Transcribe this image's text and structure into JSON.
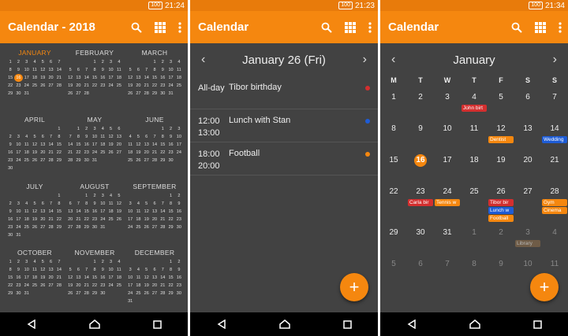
{
  "colors": {
    "accent": "#f5870f",
    "statusbar": "#e87b0b",
    "background": "#424242",
    "red": "#d32f2f",
    "blue": "#1e5cd6",
    "orange": "#f5870f",
    "brown": "#8d6e4b"
  },
  "status": [
    {
      "battery": "100",
      "time": "21:24"
    },
    {
      "battery": "100",
      "time": "21:23"
    },
    {
      "battery": "100",
      "time": "21:34"
    }
  ],
  "year_screen": {
    "title": "Calendar - 2018",
    "months": [
      {
        "name": "JANUARY",
        "current": true,
        "days": [
          "1",
          "2",
          "3",
          "4",
          "5",
          "6",
          "7",
          "8",
          "9",
          "10",
          "11",
          "12",
          "13",
          "14",
          "15",
          "16",
          "17",
          "18",
          "19",
          "20",
          "21",
          "22",
          "23",
          "24",
          "25",
          "26",
          "27",
          "28",
          "29",
          "30",
          "31"
        ],
        "offset": 0
      },
      {
        "name": "FEBRUARY",
        "days": [
          "1",
          "2",
          "3",
          "4",
          "5",
          "6",
          "7",
          "8",
          "9",
          "10",
          "11",
          "12",
          "13",
          "14",
          "15",
          "16",
          "17",
          "18",
          "19",
          "20",
          "21",
          "22",
          "23",
          "24",
          "25",
          "26",
          "27",
          "28"
        ],
        "offset": 3
      },
      {
        "name": "MARCH",
        "days": [
          "1",
          "2",
          "3",
          "4",
          "5",
          "6",
          "7",
          "8",
          "9",
          "10",
          "11",
          "12",
          "13",
          "14",
          "15",
          "16",
          "17",
          "18",
          "19",
          "20",
          "21",
          "22",
          "23",
          "24",
          "25",
          "26",
          "27",
          "28",
          "29",
          "30",
          "31"
        ],
        "offset": 3
      },
      {
        "name": "APRIL",
        "days": [
          "1",
          "2",
          "3",
          "4",
          "5",
          "6",
          "7",
          "8",
          "9",
          "10",
          "11",
          "12",
          "13",
          "14",
          "15",
          "16",
          "17",
          "18",
          "19",
          "20",
          "21",
          "22",
          "23",
          "24",
          "25",
          "26",
          "27",
          "28",
          "29",
          "30"
        ],
        "offset": 6
      },
      {
        "name": "MAY",
        "days": [
          "1",
          "2",
          "3",
          "4",
          "5",
          "6",
          "7",
          "8",
          "9",
          "10",
          "11",
          "12",
          "13",
          "14",
          "15",
          "16",
          "17",
          "18",
          "19",
          "20",
          "21",
          "22",
          "23",
          "24",
          "25",
          "26",
          "27",
          "28",
          "29",
          "30",
          "31"
        ],
        "offset": 1
      },
      {
        "name": "JUNE",
        "days": [
          "1",
          "2",
          "3",
          "4",
          "5",
          "6",
          "7",
          "8",
          "9",
          "10",
          "11",
          "12",
          "13",
          "14",
          "15",
          "16",
          "17",
          "18",
          "19",
          "20",
          "21",
          "22",
          "23",
          "24",
          "25",
          "26",
          "27",
          "28",
          "29",
          "30"
        ],
        "offset": 4
      },
      {
        "name": "JULY",
        "days": [
          "1",
          "2",
          "3",
          "4",
          "5",
          "6",
          "7",
          "8",
          "9",
          "10",
          "11",
          "12",
          "13",
          "14",
          "15",
          "16",
          "17",
          "18",
          "19",
          "20",
          "21",
          "22",
          "23",
          "24",
          "25",
          "26",
          "27",
          "28",
          "29",
          "30",
          "31"
        ],
        "offset": 6
      },
      {
        "name": "AUGUST",
        "days": [
          "1",
          "2",
          "3",
          "4",
          "5",
          "6",
          "7",
          "8",
          "9",
          "10",
          "11",
          "12",
          "13",
          "14",
          "15",
          "16",
          "17",
          "18",
          "19",
          "20",
          "21",
          "22",
          "23",
          "24",
          "25",
          "26",
          "27",
          "28",
          "29",
          "30",
          "31"
        ],
        "offset": 2
      },
      {
        "name": "SEPTEMBER",
        "days": [
          "1",
          "2",
          "3",
          "4",
          "5",
          "6",
          "7",
          "8",
          "9",
          "10",
          "11",
          "12",
          "13",
          "14",
          "15",
          "16",
          "17",
          "18",
          "19",
          "20",
          "21",
          "22",
          "23",
          "24",
          "25",
          "26",
          "27",
          "28",
          "29",
          "30"
        ],
        "offset": 5
      },
      {
        "name": "OCTOBER",
        "days": [
          "1",
          "2",
          "3",
          "4",
          "5",
          "6",
          "7",
          "8",
          "9",
          "10",
          "11",
          "12",
          "13",
          "14",
          "15",
          "16",
          "17",
          "18",
          "19",
          "20",
          "21",
          "22",
          "23",
          "24",
          "25",
          "26",
          "27",
          "28",
          "29",
          "30",
          "31"
        ],
        "offset": 0
      },
      {
        "name": "NOVEMBER",
        "days": [
          "1",
          "2",
          "3",
          "4",
          "5",
          "6",
          "7",
          "8",
          "9",
          "10",
          "11",
          "12",
          "13",
          "14",
          "15",
          "16",
          "17",
          "18",
          "19",
          "20",
          "21",
          "22",
          "23",
          "24",
          "25",
          "26",
          "27",
          "28",
          "29",
          "30"
        ],
        "offset": 3
      },
      {
        "name": "DECEMBER",
        "days": [
          "1",
          "2",
          "3",
          "4",
          "5",
          "6",
          "7",
          "8",
          "9",
          "10",
          "11",
          "12",
          "13",
          "14",
          "15",
          "16",
          "17",
          "18",
          "19",
          "20",
          "21",
          "22",
          "23",
          "24",
          "25",
          "26",
          "27",
          "28",
          "29",
          "30",
          "31"
        ],
        "offset": 5
      }
    ]
  },
  "day_screen": {
    "title": "Calendar",
    "date": "January 26 (Fri)",
    "events": [
      {
        "time": "All-day",
        "time2": "",
        "title": "Tibor birthday",
        "color": "#d32f2f"
      },
      {
        "time": "12:00",
        "time2": "13:00",
        "title": "Lunch with Stan",
        "color": "#1e5cd6"
      },
      {
        "time": "18:00",
        "time2": "20:00",
        "title": "Football",
        "color": "#f5870f"
      }
    ],
    "fab": "+"
  },
  "month_screen": {
    "title": "Calendar",
    "month": "January",
    "weekdays": [
      "M",
      "T",
      "W",
      "T",
      "F",
      "S",
      "S"
    ],
    "days": [
      {
        "n": "1"
      },
      {
        "n": "2"
      },
      {
        "n": "3"
      },
      {
        "n": "4",
        "chips": [
          {
            "t": "John birt",
            "c": "#d32f2f"
          }
        ]
      },
      {
        "n": "5"
      },
      {
        "n": "6"
      },
      {
        "n": "7"
      },
      {
        "n": "8"
      },
      {
        "n": "9"
      },
      {
        "n": "10"
      },
      {
        "n": "11"
      },
      {
        "n": "12",
        "chips": [
          {
            "t": "Dentist",
            "c": "#f5870f"
          }
        ]
      },
      {
        "n": "13"
      },
      {
        "n": "14",
        "chips": [
          {
            "t": "Wedding",
            "c": "#1e5cd6"
          }
        ]
      },
      {
        "n": "15"
      },
      {
        "n": "16",
        "today": true
      },
      {
        "n": "17"
      },
      {
        "n": "18"
      },
      {
        "n": "19"
      },
      {
        "n": "20"
      },
      {
        "n": "21"
      },
      {
        "n": "22"
      },
      {
        "n": "23",
        "chips": [
          {
            "t": "Carla bir",
            "c": "#d32f2f"
          }
        ]
      },
      {
        "n": "24",
        "chips": [
          {
            "t": "Tennis w",
            "c": "#f5870f"
          }
        ]
      },
      {
        "n": "25"
      },
      {
        "n": "26",
        "chips": [
          {
            "t": "Tibor bir",
            "c": "#d32f2f"
          },
          {
            "t": "Lunch w",
            "c": "#1e5cd6"
          },
          {
            "t": "Football",
            "c": "#f5870f"
          }
        ]
      },
      {
        "n": "27"
      },
      {
        "n": "28",
        "chips": [
          {
            "t": "Gym",
            "c": "#f5870f"
          },
          {
            "t": "Cinema",
            "c": "#f5870f"
          }
        ]
      },
      {
        "n": "29"
      },
      {
        "n": "30"
      },
      {
        "n": "31"
      },
      {
        "n": "1",
        "dim": true
      },
      {
        "n": "2",
        "dim": true
      },
      {
        "n": "3",
        "dim": true,
        "chips": [
          {
            "t": "Library",
            "c": "#8d6e4b"
          }
        ]
      },
      {
        "n": "4",
        "dim": true
      },
      {
        "n": "5",
        "dim": true
      },
      {
        "n": "6",
        "dim": true
      },
      {
        "n": "7",
        "dim": true
      },
      {
        "n": "8",
        "dim": true
      },
      {
        "n": "9",
        "dim": true
      },
      {
        "n": "10",
        "dim": true
      },
      {
        "n": "11",
        "dim": true
      }
    ],
    "fab": "+"
  }
}
